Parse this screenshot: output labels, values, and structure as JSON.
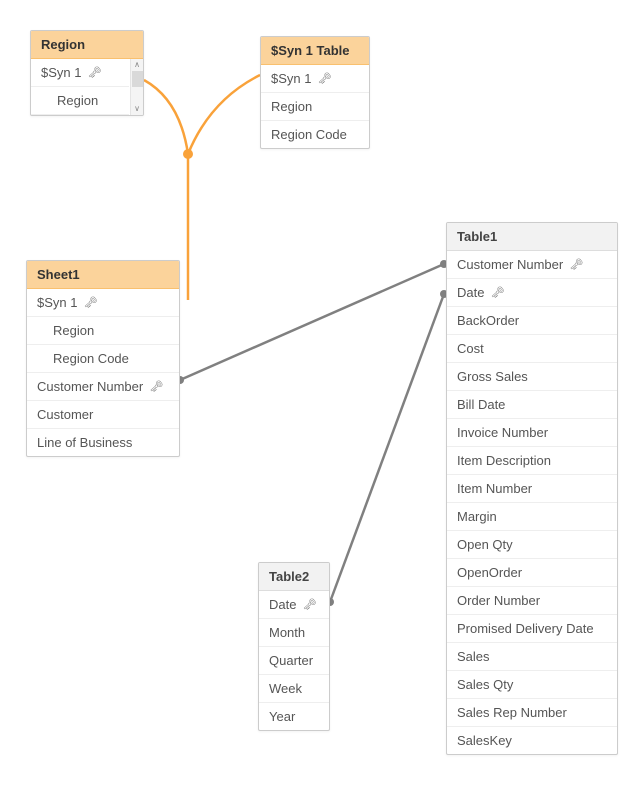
{
  "colors": {
    "accent_header": "#fbd39b",
    "link_orange": "#f9a23a",
    "link_gray": "#808080"
  },
  "tables": {
    "region": {
      "title": "Region",
      "fields": [
        {
          "label": "$Syn 1",
          "key": true
        },
        {
          "label": "Region",
          "key": false,
          "indent": true
        }
      ]
    },
    "syn1": {
      "title": "$Syn 1 Table",
      "fields": [
        {
          "label": "$Syn 1",
          "key": true
        },
        {
          "label": "Region",
          "key": false
        },
        {
          "label": "Region Code",
          "key": false
        }
      ]
    },
    "sheet1": {
      "title": "Sheet1",
      "fields": [
        {
          "label": "$Syn 1",
          "key": true
        },
        {
          "label": "Region",
          "key": false,
          "indent": true
        },
        {
          "label": "Region Code",
          "key": false,
          "indent": true
        },
        {
          "label": "Customer Number",
          "key": true
        },
        {
          "label": "Customer",
          "key": false
        },
        {
          "label": "Line of Business",
          "key": false
        }
      ]
    },
    "table1": {
      "title": "Table1",
      "fields": [
        {
          "label": "Customer Number",
          "key": true
        },
        {
          "label": "Date",
          "key": true
        },
        {
          "label": "BackOrder",
          "key": false
        },
        {
          "label": "Cost",
          "key": false
        },
        {
          "label": "Gross Sales",
          "key": false
        },
        {
          "label": "Bill Date",
          "key": false
        },
        {
          "label": "Invoice Number",
          "key": false
        },
        {
          "label": "Item Description",
          "key": false
        },
        {
          "label": "Item Number",
          "key": false
        },
        {
          "label": "Margin",
          "key": false
        },
        {
          "label": "Open Qty",
          "key": false
        },
        {
          "label": "OpenOrder",
          "key": false
        },
        {
          "label": "Order Number",
          "key": false
        },
        {
          "label": "Promised Delivery Date",
          "key": false
        },
        {
          "label": "Sales",
          "key": false
        },
        {
          "label": "Sales Qty",
          "key": false
        },
        {
          "label": "Sales Rep Number",
          "key": false
        },
        {
          "label": "SalesKey",
          "key": false
        }
      ]
    },
    "table2": {
      "title": "Table2",
      "fields": [
        {
          "label": "Date",
          "key": true
        },
        {
          "label": "Month",
          "key": false
        },
        {
          "label": "Quarter",
          "key": false
        },
        {
          "label": "Week",
          "key": false
        },
        {
          "label": "Year",
          "key": false
        }
      ]
    }
  },
  "icons": {
    "key": "🔑"
  }
}
